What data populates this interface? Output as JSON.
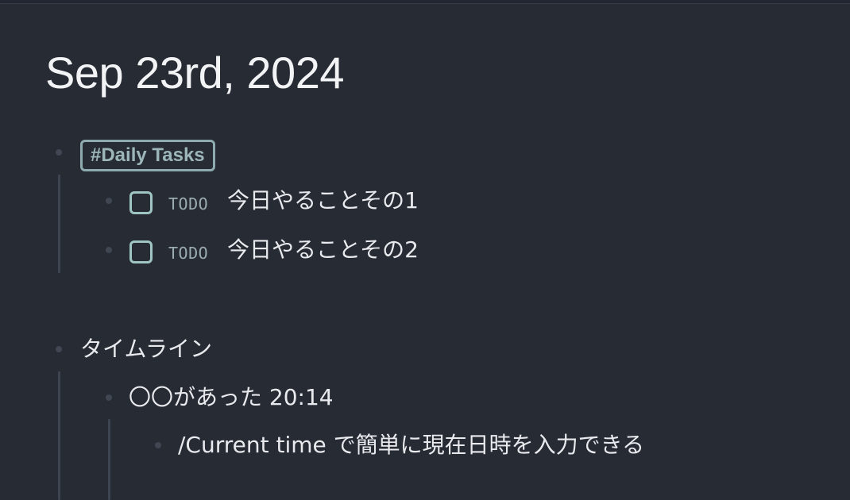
{
  "page": {
    "title": "Sep 23rd, 2024"
  },
  "blocks": {
    "daily_tag": "#Daily Tasks",
    "todos": [
      {
        "marker": "TODO",
        "text": "今日やることその1"
      },
      {
        "marker": "TODO",
        "text": "今日やることその2"
      }
    ],
    "timeline": {
      "label": "タイムライン",
      "entry": "〇〇があった 20:14",
      "hint": "/Current time で簡単に現在日時を入力できる"
    }
  },
  "colors": {
    "background": "#272b34",
    "tag_border": "#8eacb0",
    "checkbox_border": "#9ec4c4"
  }
}
